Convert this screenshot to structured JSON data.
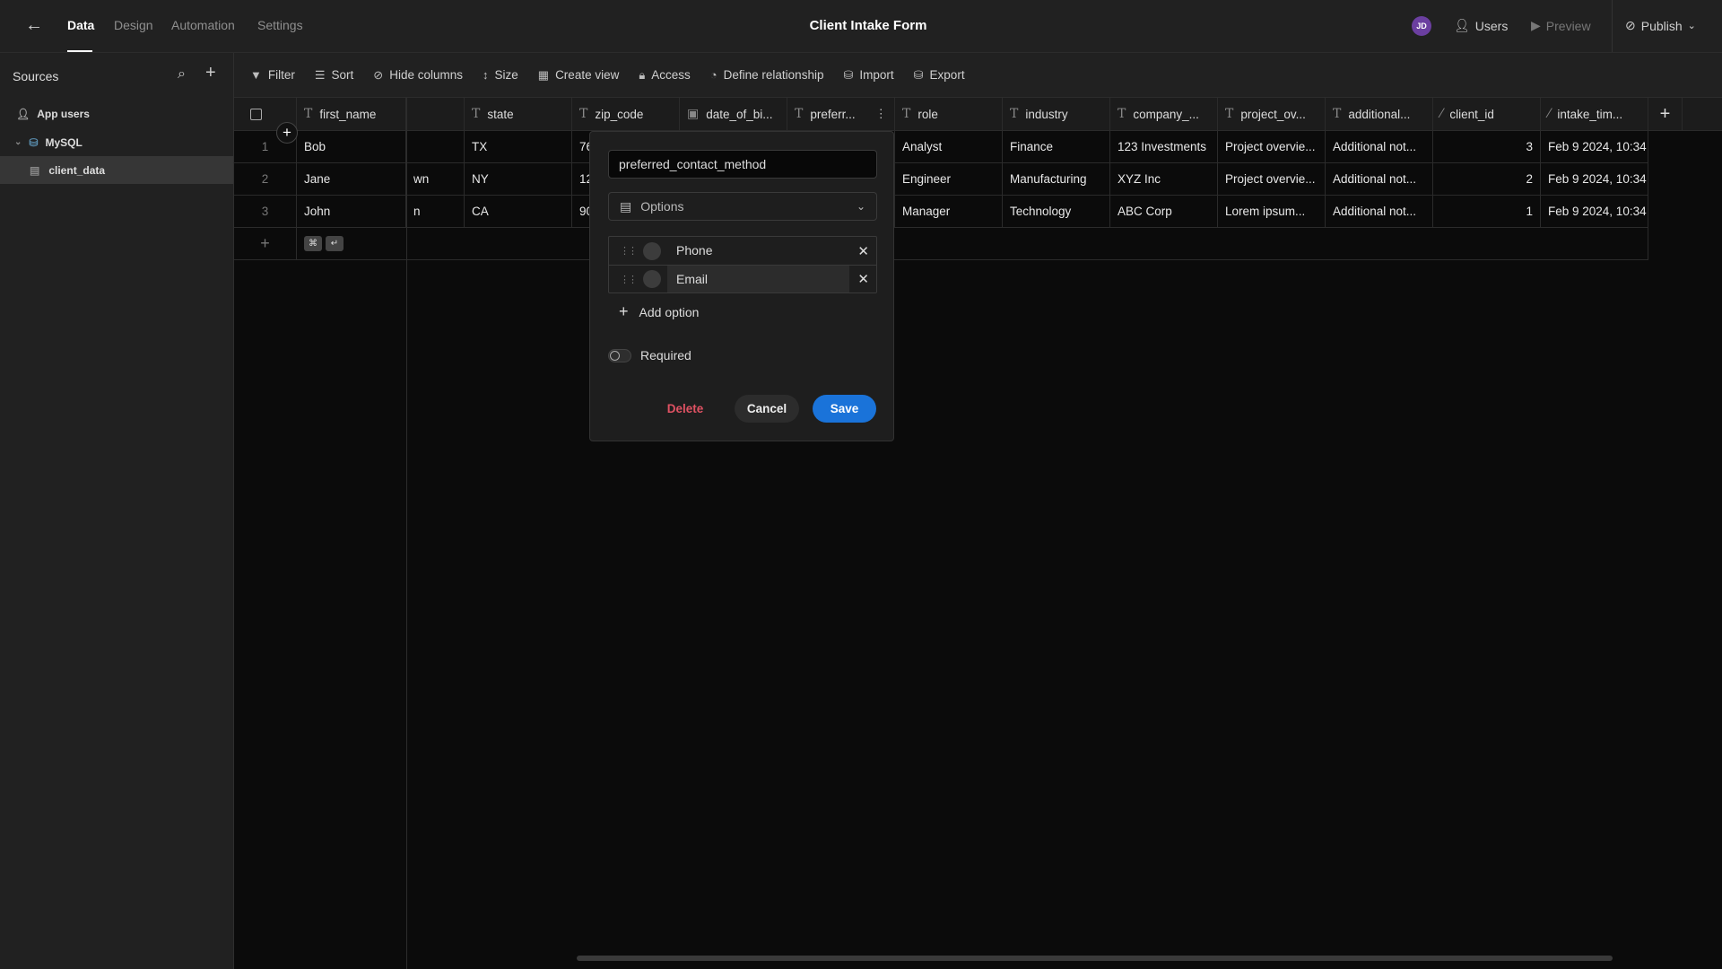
{
  "topbar": {
    "tabs": [
      "Data",
      "Design",
      "Automation",
      "Settings"
    ],
    "active_tab": "Data",
    "title": "Client Intake Form",
    "avatar": "JD",
    "users": "Users",
    "preview": "Preview",
    "publish": "Publish"
  },
  "sidebar": {
    "title": "Sources",
    "items": [
      {
        "label": "App users",
        "icon": "user-icon"
      },
      {
        "label": "MySQL",
        "icon": "database-icon"
      },
      {
        "label": "client_data",
        "icon": "table-icon",
        "selected": true
      }
    ]
  },
  "toolbar": {
    "items": [
      "Filter",
      "Sort",
      "Hide columns",
      "Size",
      "Create view",
      "Access",
      "Define relationship",
      "Import",
      "Export"
    ]
  },
  "table": {
    "columns": [
      {
        "name": "first_name",
        "type": "text"
      },
      {
        "name": "",
        "type": "text"
      },
      {
        "name": "state",
        "type": "text"
      },
      {
        "name": "zip_code",
        "type": "text"
      },
      {
        "name": "date_of_bi...",
        "type": "date"
      },
      {
        "name": "preferr...",
        "type": "text"
      },
      {
        "name": "role",
        "type": "text"
      },
      {
        "name": "industry",
        "type": "text"
      },
      {
        "name": "company_...",
        "type": "text"
      },
      {
        "name": "project_ov...",
        "type": "text"
      },
      {
        "name": "additional...",
        "type": "text"
      },
      {
        "name": "client_id",
        "type": "auto"
      },
      {
        "name": "intake_tim...",
        "type": "auto"
      }
    ],
    "rows": [
      {
        "num": "1",
        "cells": [
          "Bob",
          "",
          "TX",
          "76",
          "",
          "",
          "Analyst",
          "Finance",
          "123 Investments",
          "Project overvie...",
          "Additional not...",
          "3",
          "Feb 9 2024, 10:34"
        ]
      },
      {
        "num": "2",
        "cells": [
          "Jane",
          "wn",
          "NY",
          "12",
          "",
          "",
          "Engineer",
          "Manufacturing",
          "XYZ Inc",
          "Project overvie...",
          "Additional not...",
          "2",
          "Feb 9 2024, 10:34"
        ]
      },
      {
        "num": "3",
        "cells": [
          "John",
          "n",
          "CA",
          "90",
          "",
          "",
          "Manager",
          "Technology",
          "ABC Corp",
          "Lorem ipsum...",
          "Additional not...",
          "1",
          "Feb 9 2024, 10:34"
        ]
      }
    ],
    "add_row_keys": [
      "⌘",
      "↵"
    ]
  },
  "popup": {
    "column_name": "preferred_contact_method",
    "type": "Options",
    "options": [
      "Phone",
      "Email"
    ],
    "add_option": "Add option",
    "required_label": "Required",
    "required": false,
    "delete": "Delete",
    "cancel": "Cancel",
    "save": "Save"
  },
  "colors": {
    "save": "#1a73d9",
    "delete": "#e05263",
    "avatar": "#6b3fa0"
  }
}
